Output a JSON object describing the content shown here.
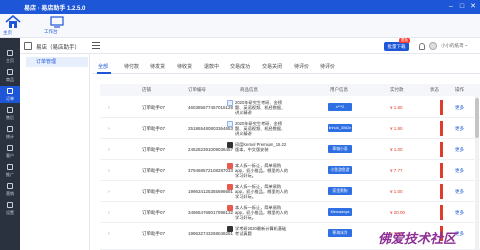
{
  "window": {
    "title": "易店 · 易店助手 1.2.5.0"
  },
  "topnav": {
    "logo_label": "主页",
    "workspace_label": "工作台"
  },
  "sidebar": {
    "items": [
      {
        "label": "主页",
        "icon": "home-icon"
      },
      {
        "label": "商品",
        "icon": "goods-icon"
      },
      {
        "label": "订单",
        "icon": "order-icon"
      },
      {
        "label": "售后",
        "icon": "aftersale-icon"
      },
      {
        "label": "统计",
        "icon": "stats-icon"
      },
      {
        "label": "客户",
        "icon": "customer-icon"
      },
      {
        "label": "推广",
        "icon": "promo-icon"
      },
      {
        "label": "营销",
        "icon": "marketing-icon"
      },
      {
        "label": "设置",
        "icon": "settings-icon"
      }
    ]
  },
  "header": {
    "store_name": "易店（易店助手）",
    "download_label": "批量下载",
    "badge": "限免",
    "username": "小小的纸鸢 ~"
  },
  "subnav": {
    "items": [
      "订单管理"
    ]
  },
  "tabs": [
    "全部",
    "待付款",
    "待发货",
    "待收货",
    "退款中",
    "交易成功",
    "交易关闭",
    "待评价",
    "待评价"
  ],
  "table": {
    "columns": [
      "店铺",
      "订单编号",
      "商品信息",
      "用户信息",
      "实付款",
      "状态",
      "操作"
    ],
    "rows": [
      {
        "seller": "订单助手07",
        "order_no": "460385677457015128",
        "desc": "2020年研究生考研、金榜题、英语视频、机经数据、讲义精讲",
        "tag": "c***2",
        "price": "¥ 1.80",
        "more": "更多"
      },
      {
        "seller": "订单助手07",
        "order_no": "251865480803364653",
        "desc": "2020年研究生考研、金榜题、英语视频、机经数据、讲义精讲",
        "tag": "linhuk_3062n",
        "price": "¥ 1.80",
        "more": "更多"
      },
      {
        "seller": "订单助手07",
        "order_no": "245282391009036457",
        "desc": "印度Kernel Premium_15.22版本，中文版安装",
        "tag": "翠城小语",
        "price": "¥ 1.00",
        "more": "更多"
      },
      {
        "seller": "订单助手07",
        "order_no": "379468572108287033",
        "desc": "本人拆一拆让，简单易购app，初小推品，哪里的人的学习好玩。",
        "tag": "小鱼游鱼游",
        "price": "¥ 7.77",
        "more": "更多"
      },
      {
        "seller": "订单助手07",
        "order_no": "199634125355698681",
        "desc": "本人拆一拆让，简单易购app，初小推品，哪里的人的学习好玩。",
        "tag": "家里黑狗",
        "price": "¥ 1.00",
        "more": "更多"
      },
      {
        "seller": "订单助手07",
        "order_no": "349654768017998132",
        "desc": "本人拆一拆让，简单易购app，初小推品，哪里的人的学习好玩。",
        "tag": "Mercadoya",
        "price": "¥ 20.00",
        "more": "更多"
      },
      {
        "seller": "订单助手07",
        "order_no": "199632743268048261",
        "desc": "学考研2020最新计算机基础考试真题",
        "tag": "寒海冰冷",
        "price": "¥ 1.80",
        "more": "更多"
      }
    ]
  },
  "watermark": "佛爱技术社区",
  "colors": {
    "accent": "#1d56d6",
    "price": "#e03b2b",
    "sidebar": "#2a3240",
    "tag": "#2f6fe4",
    "watermark": "#8e2f95"
  }
}
